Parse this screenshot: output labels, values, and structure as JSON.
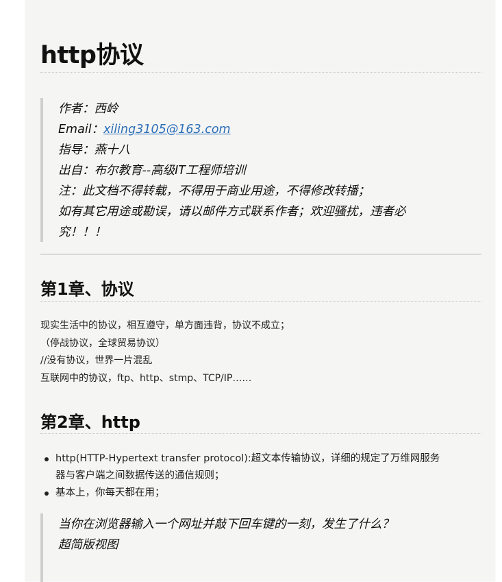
{
  "doc": {
    "title": "http协议",
    "meta_quote": {
      "author": "作者：西岭",
      "email_label": "Email：",
      "email": "xiling3105@163.com",
      "guide": "指导：燕十八",
      "source": "出自：布尔教育--高级IT工程师培训",
      "notice": "注：此文档不得转载，不得用于商业用途，不得修改转播；",
      "contact_line1": "如有其它用途或勘误，请以邮件方式联系作者；欢迎骚扰，违者必",
      "contact_line2": "究！！！"
    },
    "chapter1": {
      "title": "第1章、协议",
      "lines": [
        "现实生活中的协议，相互遵守，单方面违背，协议不成立；",
        "（停战协议，全球贸易协议）",
        "//没有协议，世界一片混乱",
        "互联网中的协议，ftp、http、stmp、TCP/IP……"
      ]
    },
    "chapter2": {
      "title": "第2章、http",
      "bullets": [
        {
          "line1": "http(HTTP-Hypertext transfer protocol):超文本传输协议，详细的规定了万维网服务",
          "line2": "器与客户端之间数据传送的通信规则；"
        },
        {
          "line1": "基本上，你每天都在用；",
          "line2": ""
        }
      ],
      "quote": {
        "line1": "当你在浏览器输入一个网址并敲下回车键的一刻，发生了什么？",
        "line2": "超简版视图"
      }
    }
  }
}
